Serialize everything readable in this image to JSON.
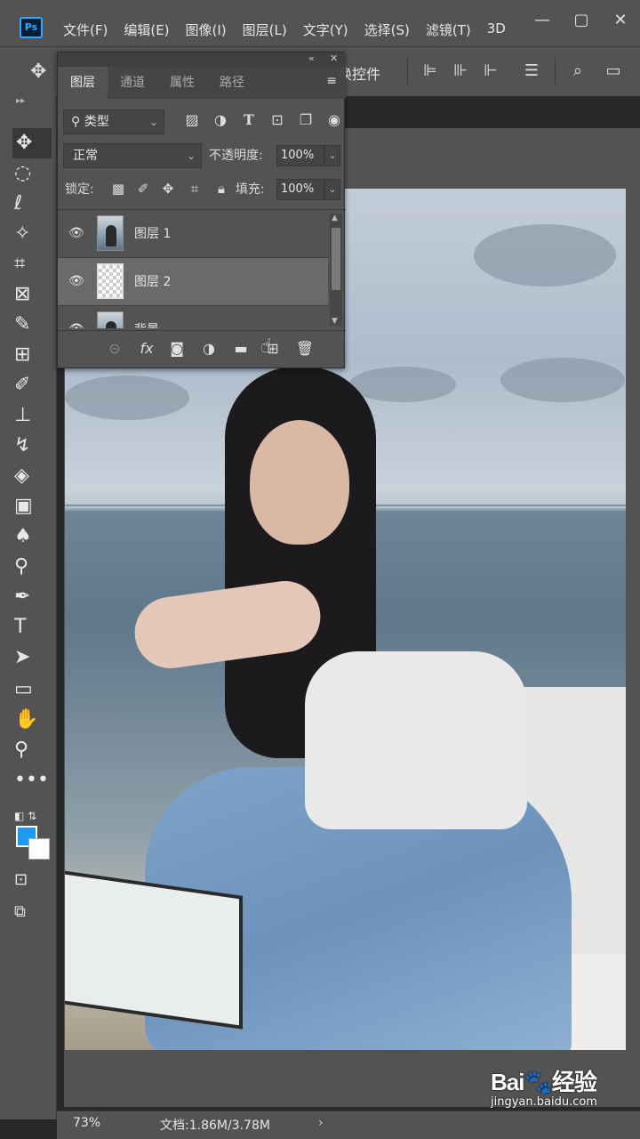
{
  "menubar": {
    "logo": "Ps",
    "items": [
      "文件(F)",
      "编辑(E)",
      "图像(I)",
      "图层(L)",
      "文字(Y)",
      "选择(S)",
      "滤镜(T)",
      "3D"
    ],
    "window_buttons": [
      "—",
      "▢",
      "✕"
    ]
  },
  "optionsbar": {
    "move_icon": "✥",
    "partial_text": "换控件"
  },
  "layers_panel": {
    "collapse_icon": "«",
    "close_icon": "✕",
    "tabs": [
      "图层",
      "通道",
      "属性",
      "路径"
    ],
    "menu_icon": "≡",
    "filter_label": "类型",
    "blend_mode": "正常",
    "opacity_label": "不透明度:",
    "opacity_value": "100%",
    "lock_label": "锁定:",
    "fill_label": "填充:",
    "fill_value": "100%",
    "layers": [
      {
        "name": "图层 1"
      },
      {
        "name": "图层 2"
      },
      {
        "name": "背景"
      }
    ]
  },
  "statusbar": {
    "zoom": "73%",
    "doc_info": "文档:1.86M/3.78M",
    "arrow": "›"
  },
  "watermark": {
    "logo": "Bai🐾经验",
    "url": "jingyan.baidu.com"
  },
  "colors": {
    "foreground": "#1e9bf0",
    "background": "#ffffff",
    "ui_panel": "#535353"
  }
}
